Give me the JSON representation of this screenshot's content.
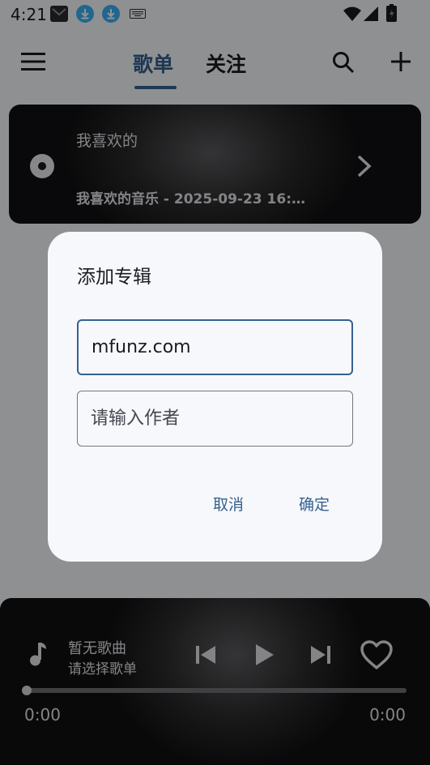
{
  "status_bar": {
    "time": "4:21",
    "left_icons": [
      "mail-icon",
      "download-icon",
      "download-icon",
      "keyboard-icon"
    ],
    "right_icons": [
      "wifi-icon",
      "signal-icon",
      "battery-icon"
    ]
  },
  "top_bar": {
    "tabs": [
      {
        "label": "歌单",
        "active": true
      },
      {
        "label": "关注",
        "active": false
      }
    ],
    "accent_color": "#35618e"
  },
  "favorites_card": {
    "title": "我喜欢的",
    "subtitle": "我喜欢的音乐 - 2025-09-23 16:…"
  },
  "dialog": {
    "title": "添加专辑",
    "name_value": "mfunz.com",
    "author_placeholder": "请输入作者",
    "cancel_label": "取消",
    "confirm_label": "确定"
  },
  "player": {
    "title": "暂无歌曲",
    "subtitle": "请选择歌单",
    "time_current": "0:00",
    "time_total": "0:00",
    "progress": 0
  }
}
